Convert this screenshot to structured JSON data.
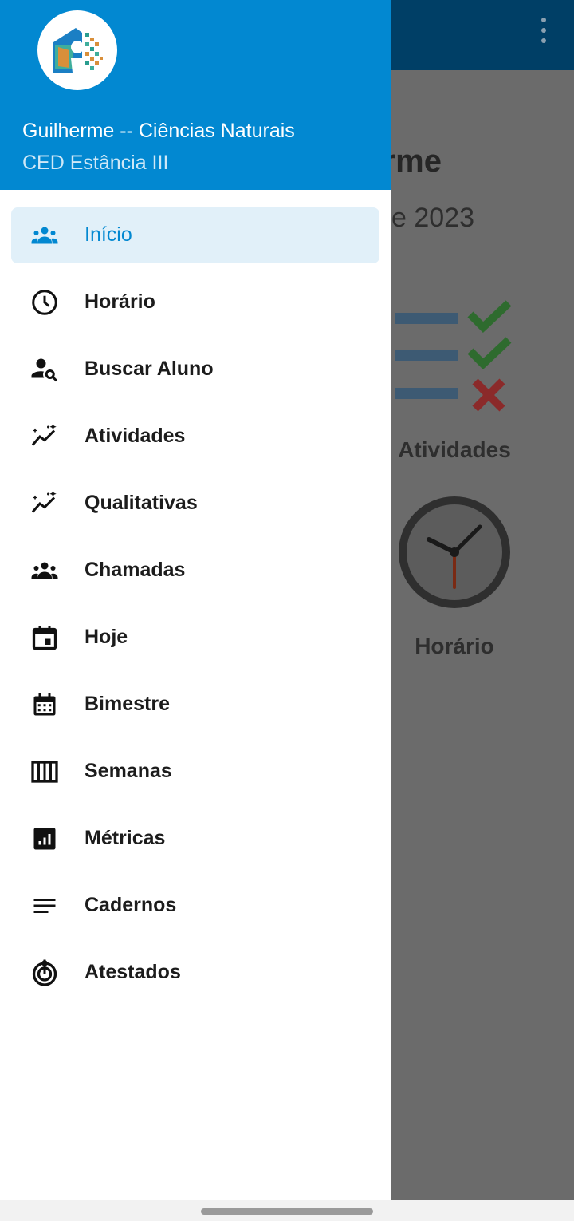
{
  "background": {
    "greeting_fragment": "rme",
    "date_fragment": "e 2023",
    "tiles": [
      {
        "label": "Atividades",
        "icon": "checklist-icon"
      },
      {
        "label": "Horário",
        "icon": "clock-icon"
      }
    ]
  },
  "drawer": {
    "header": {
      "avatar_icon": "school-logo-icon",
      "user_name": "Guilherme -- Ciências Naturais",
      "school_name": "CED Estância III"
    },
    "items": [
      {
        "label": "Início",
        "icon": "groups-icon",
        "active": true
      },
      {
        "label": "Horário",
        "icon": "clock-icon"
      },
      {
        "label": "Buscar Aluno",
        "icon": "person-search-icon"
      },
      {
        "label": "Atividades",
        "icon": "auto-graph-icon"
      },
      {
        "label": "Qualitativas",
        "icon": "auto-graph-icon"
      },
      {
        "label": "Chamadas",
        "icon": "groups-icon"
      },
      {
        "label": "Hoje",
        "icon": "event-today-icon"
      },
      {
        "label": "Bimestre",
        "icon": "calendar-month-icon"
      },
      {
        "label": "Semanas",
        "icon": "view-week-icon"
      },
      {
        "label": "Métricas",
        "icon": "analytics-icon"
      },
      {
        "label": "Cadernos",
        "icon": "notes-icon"
      },
      {
        "label": "Atestados",
        "icon": "target-icon"
      }
    ]
  },
  "colors": {
    "primary": "#0288d1",
    "appbar_dimmed": "#003f66",
    "active_item_bg": "#e1f0f9",
    "scrim": "#6b6b6b"
  }
}
